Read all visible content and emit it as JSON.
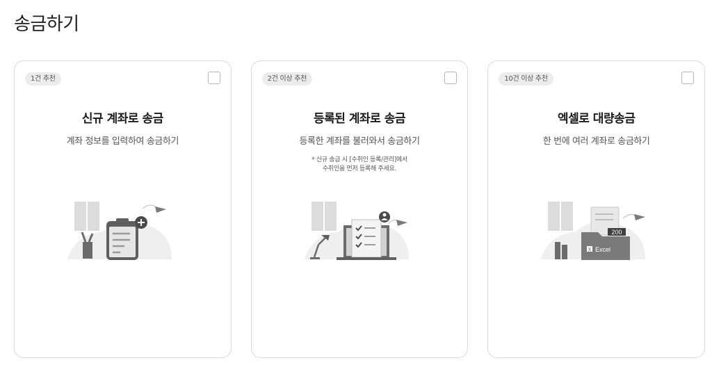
{
  "page": {
    "title": "송금하기"
  },
  "cards": [
    {
      "badge": "1건 추천",
      "title": "신규 계좌로 송금",
      "description": "계좌 정보를 입력하여 송금하기",
      "illustration_icon": "clipboard-add-icon"
    },
    {
      "badge": "2건 이상 추천",
      "title": "등록된 계좌로 송금",
      "description": "등록한 계좌를 불러와서 송금하기",
      "note_line1": "* 신규 송금 시 [수취인 등록/관리]에서",
      "note_line2": "수취인을 먼저 등록해 주세요.",
      "illustration_icon": "laptop-checklist-icon"
    },
    {
      "badge": "10건 이상 추천",
      "title": "엑셀로 대량송금",
      "description": "한 번에 여러 계좌로 송금하기",
      "illustration_icon": "excel-folder-icon",
      "illustration_count": "200",
      "illustration_label": "Excel"
    }
  ],
  "colors": {
    "card_border": "#dadada",
    "badge_bg": "#ececec",
    "illustration_gray": "#d9d9d9",
    "illustration_dark": "#6b6b6b"
  }
}
